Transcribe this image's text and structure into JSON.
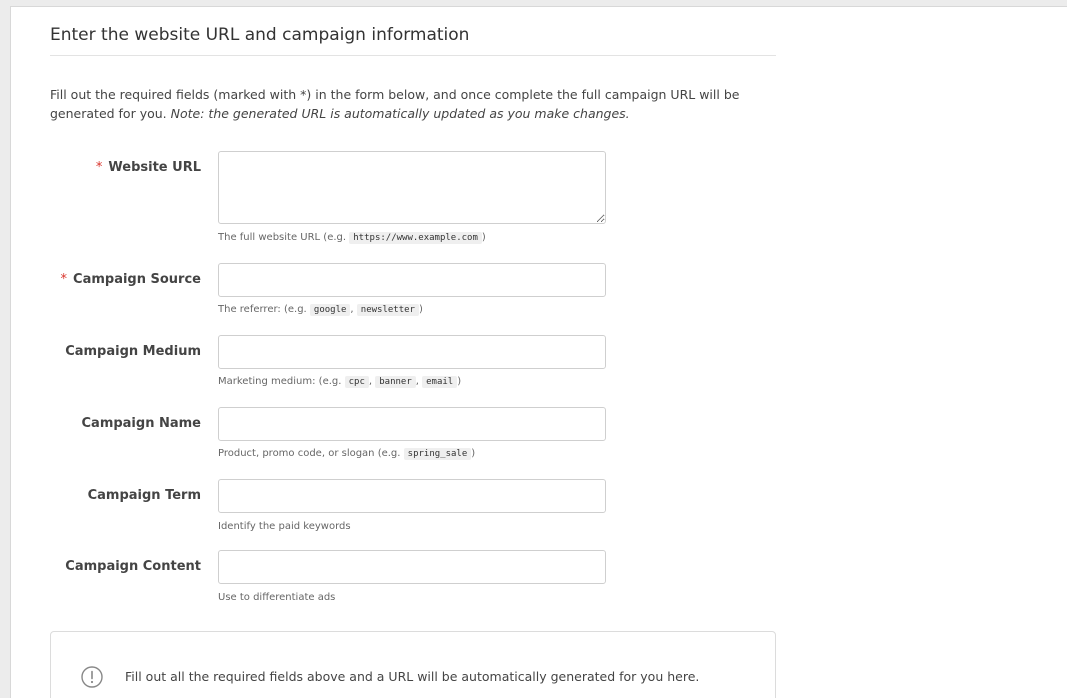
{
  "section": {
    "title": "Enter the website URL and campaign information",
    "intro_text": "Fill out the required fields (marked with *) in the form below, and once complete the full campaign URL will be generated for you.",
    "intro_note_label": "Note:",
    "intro_note_text": "the generated URL is automatically updated as you make changes."
  },
  "fields": {
    "website_url": {
      "required_mark": "*",
      "label": "Website URL",
      "value": "",
      "help_prefix": "The full website URL (e.g.",
      "help_codes": [
        "https://www.example.com"
      ],
      "help_suffix": ")"
    },
    "campaign_source": {
      "required_mark": "*",
      "label": "Campaign Source",
      "value": "",
      "help_prefix": "The referrer: (e.g.",
      "help_codes": [
        "google",
        "newsletter"
      ],
      "help_suffix": ")"
    },
    "campaign_medium": {
      "label": "Campaign Medium",
      "value": "",
      "help_prefix": "Marketing medium: (e.g.",
      "help_codes": [
        "cpc",
        "banner",
        "email"
      ],
      "help_suffix": ")"
    },
    "campaign_name": {
      "label": "Campaign Name",
      "value": "",
      "help_prefix": "Product, promo code, or slogan (e.g.",
      "help_codes": [
        "spring_sale"
      ],
      "help_suffix": ")"
    },
    "campaign_term": {
      "label": "Campaign Term",
      "value": "",
      "help": "Identify the paid keywords"
    },
    "campaign_content": {
      "label": "Campaign Content",
      "value": "",
      "help": "Use to differentiate ads"
    }
  },
  "result": {
    "icon": "info-circle-icon",
    "message": "Fill out all the required fields above and a URL will be automatically generated for you here."
  },
  "colors": {
    "required": "#d9332b",
    "background": "#ececec",
    "panel": "#ffffff"
  }
}
